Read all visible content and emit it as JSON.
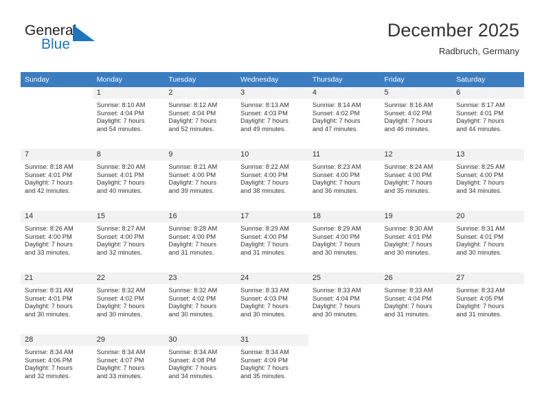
{
  "brand": {
    "name_part1": "General",
    "name_part2": "Blue",
    "accent_color": "#1c76bc",
    "logo_icon": "triangle-logo-icon"
  },
  "header": {
    "title": "December 2025",
    "subtitle": "Radbruch, Germany"
  },
  "calendar": {
    "header_bg": "#3b7dc0",
    "daynum_bg": "#f2f2f2",
    "weekday_headers": [
      "Sunday",
      "Monday",
      "Tuesday",
      "Wednesday",
      "Thursday",
      "Friday",
      "Saturday"
    ],
    "weeks": [
      [
        {
          "day": "",
          "sunrise": "",
          "sunset": "",
          "daylight1": "",
          "daylight2": ""
        },
        {
          "day": "1",
          "sunrise": "Sunrise: 8:10 AM",
          "sunset": "Sunset: 4:04 PM",
          "daylight1": "Daylight: 7 hours",
          "daylight2": "and 54 minutes."
        },
        {
          "day": "2",
          "sunrise": "Sunrise: 8:12 AM",
          "sunset": "Sunset: 4:04 PM",
          "daylight1": "Daylight: 7 hours",
          "daylight2": "and 52 minutes."
        },
        {
          "day": "3",
          "sunrise": "Sunrise: 8:13 AM",
          "sunset": "Sunset: 4:03 PM",
          "daylight1": "Daylight: 7 hours",
          "daylight2": "and 49 minutes."
        },
        {
          "day": "4",
          "sunrise": "Sunrise: 8:14 AM",
          "sunset": "Sunset: 4:02 PM",
          "daylight1": "Daylight: 7 hours",
          "daylight2": "and 47 minutes."
        },
        {
          "day": "5",
          "sunrise": "Sunrise: 8:16 AM",
          "sunset": "Sunset: 4:02 PM",
          "daylight1": "Daylight: 7 hours",
          "daylight2": "and 46 minutes."
        },
        {
          "day": "6",
          "sunrise": "Sunrise: 8:17 AM",
          "sunset": "Sunset: 4:01 PM",
          "daylight1": "Daylight: 7 hours",
          "daylight2": "and 44 minutes."
        }
      ],
      [
        {
          "day": "7",
          "sunrise": "Sunrise: 8:18 AM",
          "sunset": "Sunset: 4:01 PM",
          "daylight1": "Daylight: 7 hours",
          "daylight2": "and 42 minutes."
        },
        {
          "day": "8",
          "sunrise": "Sunrise: 8:20 AM",
          "sunset": "Sunset: 4:01 PM",
          "daylight1": "Daylight: 7 hours",
          "daylight2": "and 40 minutes."
        },
        {
          "day": "9",
          "sunrise": "Sunrise: 8:21 AM",
          "sunset": "Sunset: 4:00 PM",
          "daylight1": "Daylight: 7 hours",
          "daylight2": "and 39 minutes."
        },
        {
          "day": "10",
          "sunrise": "Sunrise: 8:22 AM",
          "sunset": "Sunset: 4:00 PM",
          "daylight1": "Daylight: 7 hours",
          "daylight2": "and 38 minutes."
        },
        {
          "day": "11",
          "sunrise": "Sunrise: 8:23 AM",
          "sunset": "Sunset: 4:00 PM",
          "daylight1": "Daylight: 7 hours",
          "daylight2": "and 36 minutes."
        },
        {
          "day": "12",
          "sunrise": "Sunrise: 8:24 AM",
          "sunset": "Sunset: 4:00 PM",
          "daylight1": "Daylight: 7 hours",
          "daylight2": "and 35 minutes."
        },
        {
          "day": "13",
          "sunrise": "Sunrise: 8:25 AM",
          "sunset": "Sunset: 4:00 PM",
          "daylight1": "Daylight: 7 hours",
          "daylight2": "and 34 minutes."
        }
      ],
      [
        {
          "day": "14",
          "sunrise": "Sunrise: 8:26 AM",
          "sunset": "Sunset: 4:00 PM",
          "daylight1": "Daylight: 7 hours",
          "daylight2": "and 33 minutes."
        },
        {
          "day": "15",
          "sunrise": "Sunrise: 8:27 AM",
          "sunset": "Sunset: 4:00 PM",
          "daylight1": "Daylight: 7 hours",
          "daylight2": "and 32 minutes."
        },
        {
          "day": "16",
          "sunrise": "Sunrise: 8:28 AM",
          "sunset": "Sunset: 4:00 PM",
          "daylight1": "Daylight: 7 hours",
          "daylight2": "and 31 minutes."
        },
        {
          "day": "17",
          "sunrise": "Sunrise: 8:29 AM",
          "sunset": "Sunset: 4:00 PM",
          "daylight1": "Daylight: 7 hours",
          "daylight2": "and 31 minutes."
        },
        {
          "day": "18",
          "sunrise": "Sunrise: 8:29 AM",
          "sunset": "Sunset: 4:00 PM",
          "daylight1": "Daylight: 7 hours",
          "daylight2": "and 30 minutes."
        },
        {
          "day": "19",
          "sunrise": "Sunrise: 8:30 AM",
          "sunset": "Sunset: 4:01 PM",
          "daylight1": "Daylight: 7 hours",
          "daylight2": "and 30 minutes."
        },
        {
          "day": "20",
          "sunrise": "Sunrise: 8:31 AM",
          "sunset": "Sunset: 4:01 PM",
          "daylight1": "Daylight: 7 hours",
          "daylight2": "and 30 minutes."
        }
      ],
      [
        {
          "day": "21",
          "sunrise": "Sunrise: 8:31 AM",
          "sunset": "Sunset: 4:01 PM",
          "daylight1": "Daylight: 7 hours",
          "daylight2": "and 30 minutes."
        },
        {
          "day": "22",
          "sunrise": "Sunrise: 8:32 AM",
          "sunset": "Sunset: 4:02 PM",
          "daylight1": "Daylight: 7 hours",
          "daylight2": "and 30 minutes."
        },
        {
          "day": "23",
          "sunrise": "Sunrise: 8:32 AM",
          "sunset": "Sunset: 4:02 PM",
          "daylight1": "Daylight: 7 hours",
          "daylight2": "and 30 minutes."
        },
        {
          "day": "24",
          "sunrise": "Sunrise: 8:33 AM",
          "sunset": "Sunset: 4:03 PM",
          "daylight1": "Daylight: 7 hours",
          "daylight2": "and 30 minutes."
        },
        {
          "day": "25",
          "sunrise": "Sunrise: 8:33 AM",
          "sunset": "Sunset: 4:04 PM",
          "daylight1": "Daylight: 7 hours",
          "daylight2": "and 30 minutes."
        },
        {
          "day": "26",
          "sunrise": "Sunrise: 8:33 AM",
          "sunset": "Sunset: 4:04 PM",
          "daylight1": "Daylight: 7 hours",
          "daylight2": "and 31 minutes."
        },
        {
          "day": "27",
          "sunrise": "Sunrise: 8:33 AM",
          "sunset": "Sunset: 4:05 PM",
          "daylight1": "Daylight: 7 hours",
          "daylight2": "and 31 minutes."
        }
      ],
      [
        {
          "day": "28",
          "sunrise": "Sunrise: 8:34 AM",
          "sunset": "Sunset: 4:06 PM",
          "daylight1": "Daylight: 7 hours",
          "daylight2": "and 32 minutes."
        },
        {
          "day": "29",
          "sunrise": "Sunrise: 8:34 AM",
          "sunset": "Sunset: 4:07 PM",
          "daylight1": "Daylight: 7 hours",
          "daylight2": "and 33 minutes."
        },
        {
          "day": "30",
          "sunrise": "Sunrise: 8:34 AM",
          "sunset": "Sunset: 4:08 PM",
          "daylight1": "Daylight: 7 hours",
          "daylight2": "and 34 minutes."
        },
        {
          "day": "31",
          "sunrise": "Sunrise: 8:34 AM",
          "sunset": "Sunset: 4:09 PM",
          "daylight1": "Daylight: 7 hours",
          "daylight2": "and 35 minutes."
        },
        {
          "day": "",
          "sunrise": "",
          "sunset": "",
          "daylight1": "",
          "daylight2": ""
        },
        {
          "day": "",
          "sunrise": "",
          "sunset": "",
          "daylight1": "",
          "daylight2": ""
        },
        {
          "day": "",
          "sunrise": "",
          "sunset": "",
          "daylight1": "",
          "daylight2": ""
        }
      ]
    ]
  }
}
